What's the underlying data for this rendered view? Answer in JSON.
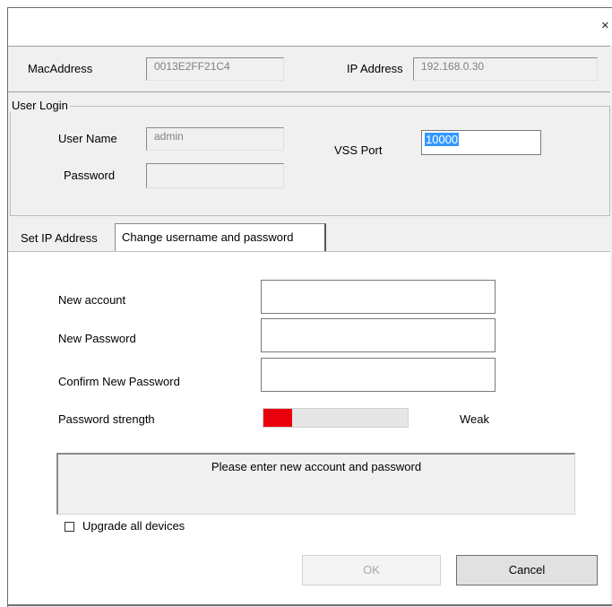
{
  "window": {
    "close_glyph": "×",
    "close_icon": "close-icon"
  },
  "device": {
    "mac_label": "MacAddress",
    "mac_value": "0013E2FF21C4",
    "ip_label": "IP Address",
    "ip_value": "192.168.0.30"
  },
  "login": {
    "group_title": "User Login",
    "username_label": "User Name",
    "username_value": "admin",
    "password_label": "Password",
    "password_value": "",
    "vss_label": "VSS Port",
    "vss_value": "10000"
  },
  "tabs": [
    {
      "label": "Set IP Address",
      "active": false
    },
    {
      "label": "Change username and password",
      "active": true
    }
  ],
  "form": {
    "new_account_label": "New account",
    "new_account_value": "",
    "new_password_label": "New Password",
    "new_password_value": "",
    "confirm_label": "Confirm New Password",
    "confirm_value": "",
    "strength_label": "Password strength",
    "strength_fraction": 0.2,
    "strength_color": "#e8000b",
    "strength_text": "Weak",
    "message": "Please enter new account and password",
    "upgrade_label": "Upgrade all devices",
    "upgrade_checked": false
  },
  "buttons": {
    "ok_label": "OK",
    "cancel_label": "Cancel"
  }
}
